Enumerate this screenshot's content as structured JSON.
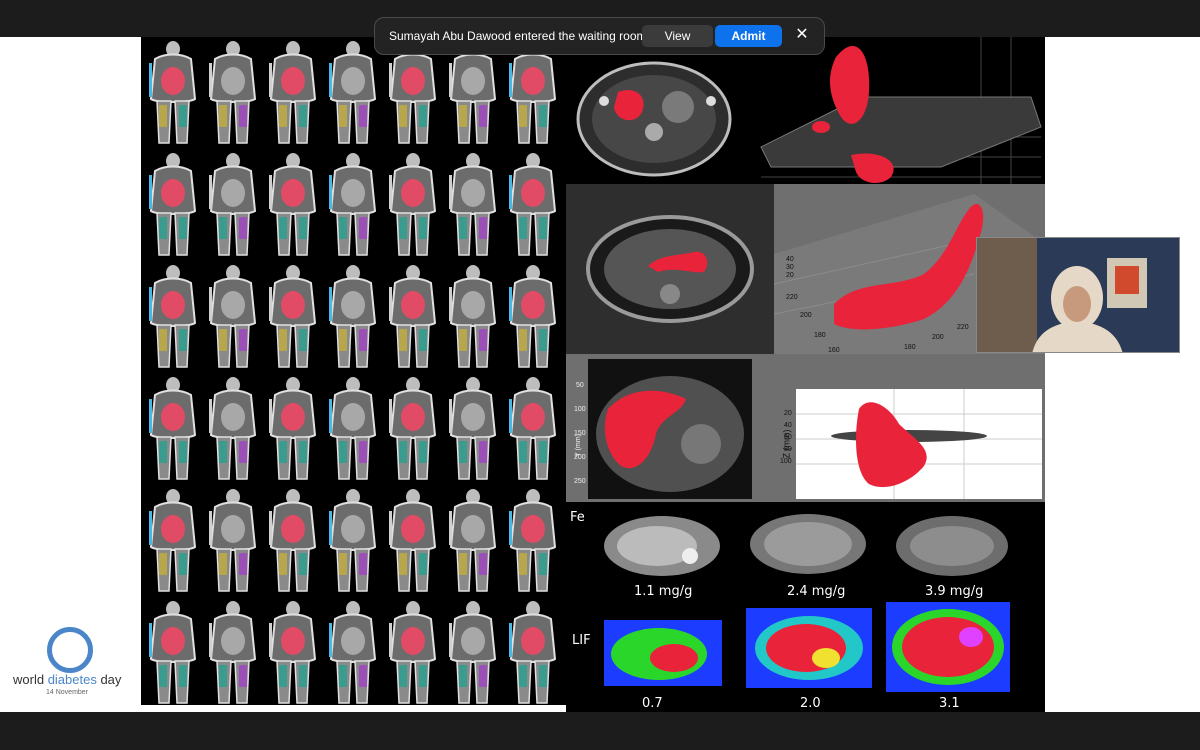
{
  "notification": {
    "message": "Sumayah Abu Dawood entered the waiting room",
    "view_label": "View",
    "admit_label": "Admit",
    "close_glyph": "✕"
  },
  "slide": {
    "fe_label": "Fe",
    "lif_label": "LIF",
    "fe_values": [
      "1.1 mg/g",
      "2.4 mg/g",
      "3.9 mg/g"
    ],
    "lif_values": [
      "0.7",
      "2.0",
      "3.1"
    ],
    "plot_a": {
      "z_ticks": [
        "40",
        "30",
        "20"
      ],
      "x_ticks": [
        "220",
        "200",
        "180",
        "160"
      ],
      "y_ticks": [
        "220",
        "200",
        "180"
      ]
    },
    "plot_b": {
      "y_label": "Y (mm)",
      "y_ticks": [
        "50",
        "100",
        "150",
        "200",
        "250"
      ]
    },
    "plot_c": {
      "z_label": "Z (mm)",
      "z_ticks": [
        "20",
        "40",
        "60",
        "80",
        "100"
      ]
    }
  },
  "logo": {
    "word1": "world ",
    "word2": "diabetes",
    "word3": " day",
    "date": "14 November"
  },
  "colors": {
    "accent_blue": "#0e72ed",
    "organ_red": "#e8233a",
    "logo_blue": "#4a86c8"
  }
}
